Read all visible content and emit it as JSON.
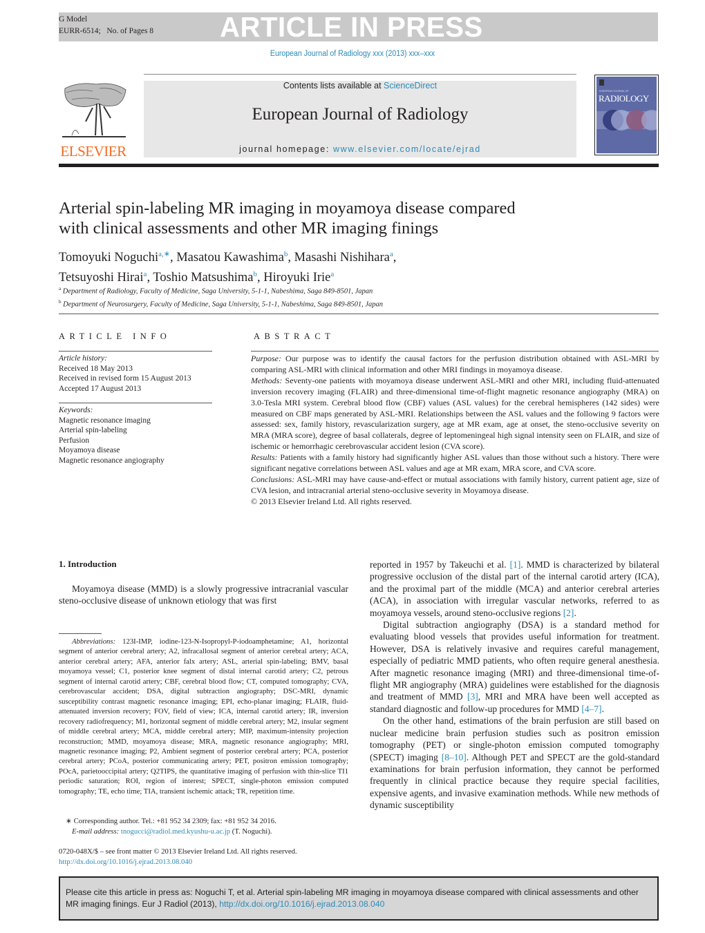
{
  "header": {
    "g_model": "G Model",
    "article_id": "EURR-6514;",
    "pages": "No. of Pages 8",
    "banner": "ARTICLE IN PRESS",
    "journal_ref": "European Journal of Radiology xxx (2013) xxx–xxx",
    "contents_prefix": "Contents lists available at ",
    "contents_link": "ScienceDirect",
    "journal_name": "European Journal of Radiology",
    "homepage_prefix": "journal homepage: ",
    "homepage_link": "www.elsevier.com/locate/ejrad",
    "publisher": "ELSEVIER",
    "cover_title": "RADIOLOGY",
    "cover_subtitle": "EUROPEAN JOURNAL OF"
  },
  "article": {
    "title_line1": "Arterial spin-labeling MR imaging in moyamoya disease compared",
    "title_line2": "with clinical assessments and other MR imaging finings",
    "authors": [
      {
        "name": "Tomoyuki Noguchi",
        "sup": "a,∗",
        "sep": ", "
      },
      {
        "name": "Masatou Kawashima",
        "sup": "b",
        "sep": ", "
      },
      {
        "name": "Masashi Nishihara",
        "sup": "a",
        "sep": ","
      },
      {
        "name": "Tetsuyoshi Hirai",
        "sup": "a",
        "sep": ", "
      },
      {
        "name": "Toshio Matsushima",
        "sup": "b",
        "sep": ", "
      },
      {
        "name": "Hiroyuki Irie",
        "sup": "a",
        "sep": ""
      }
    ],
    "affiliations": [
      {
        "sup": "a",
        "text": "Department of Radiology, Faculty of Medicine, Saga University, 5-1-1, Nabeshima, Saga 849-8501, Japan"
      },
      {
        "sup": "b",
        "text": "Department of Neurosurgery, Faculty of Medicine, Saga University, 5-1-1, Nabeshima, Saga 849-8501, Japan"
      }
    ]
  },
  "article_info": {
    "heading": "ARTICLE INFO",
    "history_label": "Article history:",
    "history": [
      "Received 18 May 2013",
      "Received in revised form 15 August 2013",
      "Accepted 17 August 2013"
    ],
    "keywords_label": "Keywords:",
    "keywords": [
      "Magnetic resonance imaging",
      "Arterial spin-labeling",
      "Perfusion",
      "Moyamoya disease",
      "Magnetic resonance angiography"
    ]
  },
  "abstract": {
    "heading": "ABSTRACT",
    "purpose_label": "Purpose:",
    "purpose": " Our purpose was to identify the causal factors for the perfusion distribution obtained with ASL-MRI by comparing ASL-MRI with clinical information and other MRI findings in moyamoya disease.",
    "methods_label": "Methods:",
    "methods": " Seventy-one patients with moyamoya disease underwent ASL-MRI and other MRI, including fluid-attenuated inversion recovery imaging (FLAIR) and three-dimensional time-of-flight magnetic resonance angiography (MRA) on 3.0-Tesla MRI system. Cerebral blood flow (CBF) values (ASL values) for the cerebral hemispheres (142 sides) were measured on CBF maps generated by ASL-MRI. Relationships between the ASL values and the following 9 factors were assessed: sex, family history, revascularization surgery, age at MR exam, age at onset, the steno-occlusive severity on MRA (MRA score), degree of basal collaterals, degree of leptomeningeal high signal intensity seen on FLAIR, and size of ischemic or hemorrhagic cerebrovascular accident lesion (CVA score).",
    "results_label": "Results:",
    "results": " Patients with a family history had significantly higher ASL values than those without such a history. There were significant negative correlations between ASL values and age at MR exam, MRA score, and CVA score.",
    "conclusions_label": "Conclusions:",
    "conclusions": " ASL-MRI may have cause-and-effect or mutual associations with family history, current patient age, size of CVA lesion, and intracranial arterial steno-occlusive severity in Moyamoya disease.",
    "copyright": "© 2013 Elsevier Ireland Ltd. All rights reserved."
  },
  "body": {
    "intro_heading": "1.  Introduction",
    "intro_p1": "Moyamoya disease (MMD) is a slowly progressive intracranial vascular steno-occlusive disease of unknown etiology that was first",
    "right_p1_a": "reported in 1957 by Takeuchi et al. ",
    "ref1": "[1]",
    "right_p1_b": ". MMD is characterized by bilateral progressive occlusion of the distal part of the internal carotid artery (ICA), and the proximal part of the middle (MCA) and anterior cerebral arteries (ACA), in association with irregular vascular networks, referred to as moyamoya vessels, around steno-occlusive regions ",
    "ref2": "[2]",
    "right_p1_c": ".",
    "right_p2_a": "Digital subtraction angiography (DSA) is a standard method for evaluating blood vessels that provides useful information for treatment. However, DSA is relatively invasive and requires careful management, especially of pediatric MMD patients, who often require general anesthesia. After magnetic resonance imaging (MRI) and three-dimensional time-of-flight MR angiography (MRA) guidelines were established for the diagnosis and treatment of MMD ",
    "ref3": "[3]",
    "right_p2_b": ", MRI and MRA have been well accepted as standard diagnostic and follow-up procedures for MMD ",
    "ref4": "[4–7]",
    "right_p2_c": ".",
    "right_p3_a": "On the other hand, estimations of the brain perfusion are still based on nuclear medicine brain perfusion studies such as positron emission tomography (PET) or single-photon emission computed tomography (SPECT) imaging ",
    "ref5": "[8–10]",
    "right_p3_b": ". Although PET and SPECT are the gold-standard examinations for brain perfusion information, they cannot be performed frequently in clinical practice because they require special facilities, expensive agents, and invasive examination methods. While new methods of dynamic susceptibility"
  },
  "footnotes": {
    "abbrev_label": "Abbreviations:",
    "abbrev_text": "  123I-IMP, iodine-123-N-Isopropyl-P-iodoamphetamine; A1, horizontal segment of anterior cerebral artery; A2, infracallosal segment of anterior cerebral artery; ACA, anterior cerebral artery; AFA, anterior falx artery; ASL, arterial spin-labeling; BMV, basal moyamoya vessel; C1, posterior knee segment of distal internal carotid artery; C2, petrous segment of internal carotid artery; CBF, cerebral blood flow; CT, computed tomography; CVA, cerebrovascular accident; DSA, digital subtraction angiography; DSC-MRI, dynamic susceptibility contrast magnetic resonance imaging; EPI, echo-planar imaging; FLAIR, fluid-attenuated inversion recovery; FOV, field of view; ICA, internal carotid artery; IR, inversion recovery radiofrequency; M1, horizontal segment of middle cerebral artery; M2, insular segment of middle cerebral artery; MCA, middle cerebral artery; MIP, maximum-intensity projection reconstruction; MMD, moyamoya disease; MRA, magnetic resonance angiography; MRI, magnetic resonance imaging; P2, Ambient segment of posterior cerebral artery; PCA, posterior cerebral artery; PCoA, posterior communicating artery; PET, positron emission tomography; POcA, parietooccipital artery; Q2TIPS, the quantitative imaging of perfusion with thin-slice TI1 periodic saturation; ROI, region of interest; SPECT, single-photon emission computed tomography; TE, echo time; TIA, transient ischemic attack; TR, repetition time.",
    "corr_text": "∗ Corresponding author. Tel.: +81 952 34 2309; fax: +81 952 34 2016.",
    "email_label": "E-mail address:",
    "email": "tnogucci@radiol.med.kyushu-u.ac.jp",
    "email_suffix": " (T. Noguchi).",
    "front_matter": "0720-048X/$ – see front matter © 2013 Elsevier Ireland Ltd. All rights reserved.",
    "doi": "http://dx.doi.org/10.1016/j.ejrad.2013.08.040"
  },
  "cite_box": {
    "text": "Please cite this article in press as: Noguchi T, et al. Arterial spin-labeling MR imaging in moyamoya disease compared with clinical assessments and other MR imaging finings. Eur J Radiol (2013), ",
    "doi": "http://dx.doi.org/10.1016/j.ejrad.2013.08.040"
  }
}
